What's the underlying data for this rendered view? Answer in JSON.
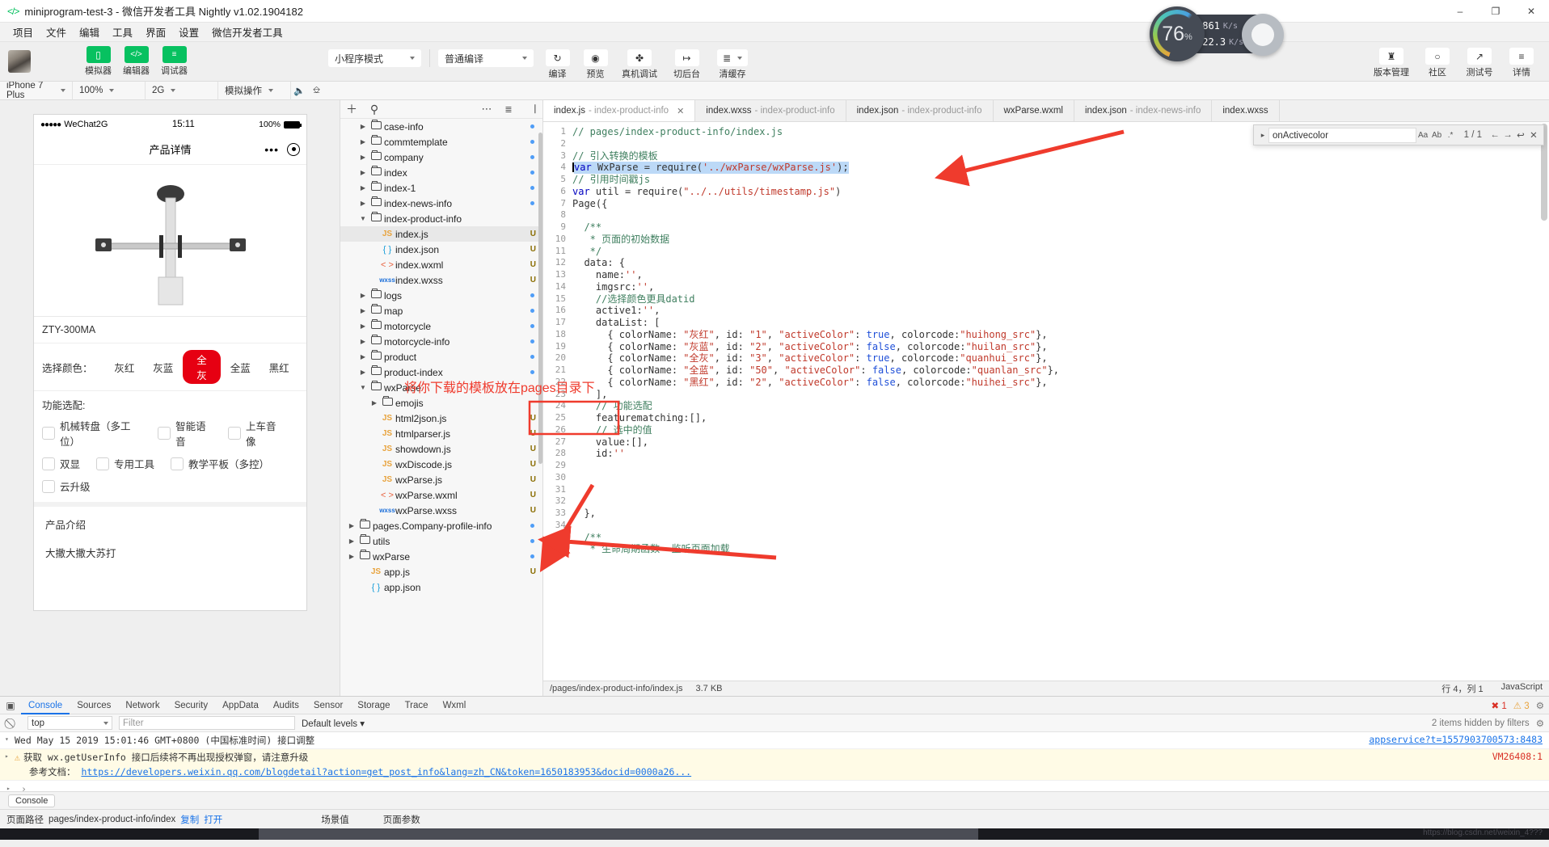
{
  "window": {
    "title": "miniprogram-test-3 - 微信开发者工具 Nightly v1.02.1904182",
    "logo_icon": "code-brackets-icon",
    "minimize": "–",
    "maximize": "❐",
    "close": "✕"
  },
  "menubar": [
    "项目",
    "文件",
    "编辑",
    "工具",
    "界面",
    "设置",
    "微信开发者工具"
  ],
  "toolbar": {
    "panels": [
      {
        "label": "模拟器",
        "icon": "phone-icon",
        "glyph": "▯",
        "active": true
      },
      {
        "label": "编辑器",
        "icon": "code-icon",
        "glyph": "</>",
        "active": true
      },
      {
        "label": "调试器",
        "icon": "sliders-icon",
        "glyph": "≡",
        "active": true
      }
    ],
    "mode_select": "小程序模式",
    "compile_select": "普通编译",
    "actions": [
      {
        "label": "编译",
        "icon": "refresh-icon",
        "glyph": "↻"
      },
      {
        "label": "预览",
        "icon": "eye-icon",
        "glyph": "◎"
      },
      {
        "label": "真机调试",
        "icon": "bug-icon",
        "glyph": "✤"
      },
      {
        "label": "切后台",
        "icon": "background-icon",
        "glyph": "↦"
      },
      {
        "label": "清缓存",
        "icon": "layers-icon",
        "glyph": "≣"
      }
    ],
    "right_actions": [
      {
        "label": "版本管理",
        "icon": "git-branch-icon",
        "glyph": "⛓"
      },
      {
        "label": "社区",
        "icon": "chat-bubble-icon",
        "glyph": "○"
      },
      {
        "label": "测试号",
        "icon": "external-link-icon",
        "glyph": "↗"
      },
      {
        "label": "详情",
        "icon": "hamburger-icon",
        "glyph": "≡"
      }
    ]
  },
  "cpu_meter": {
    "percent": "76",
    "percent_unit": "%",
    "upload": "861",
    "upload_unit": "K/s",
    "download": "22.3",
    "download_unit": "K/s",
    "up_arrow": "↑",
    "down_arrow": "↓"
  },
  "simbar": {
    "device": "iPhone 7 Plus",
    "zoom": "100%",
    "network": "2G",
    "action": "模拟操作",
    "icons": [
      "volume-icon",
      "screen-icon"
    ]
  },
  "simulator": {
    "status": {
      "signal_dots": "●●●●●",
      "carrier": "WeChat2G",
      "time": "15:11",
      "battery_pct": "100%"
    },
    "nav_title": "产品详情",
    "product_image_alt": "product-photo",
    "product_name": "ZTY-300MA",
    "color_label": "选择颜色：",
    "colors": [
      {
        "name": "灰红",
        "active": false
      },
      {
        "name": "灰蓝",
        "active": false
      },
      {
        "name": "全灰",
        "active": true
      },
      {
        "name": "全蓝",
        "active": false
      },
      {
        "name": "黑红",
        "active": false
      }
    ],
    "feature_label": "功能选配:",
    "features_row1": [
      "机械转盘（多工位）",
      "智能语音",
      "上车音像"
    ],
    "features_row2": [
      "双显",
      "专用工具",
      "教学平板（多控）"
    ],
    "features_row3": [
      "云升级"
    ],
    "intro_title": "产品介绍",
    "intro_body": "大撒大撒大苏打"
  },
  "filetree": {
    "toolbar": {
      "add": "＋",
      "search": "search-icon",
      "more": "⋯",
      "sort": "sort-icon",
      "collapse": "collapse-icon"
    },
    "items": [
      {
        "indent": 1,
        "type": "folder",
        "name": "case-info",
        "expanded": false,
        "badge": "dot"
      },
      {
        "indent": 1,
        "type": "folder",
        "name": "commtemplate",
        "expanded": false,
        "badge": "dot"
      },
      {
        "indent": 1,
        "type": "folder",
        "name": "company",
        "expanded": false,
        "badge": "dot"
      },
      {
        "indent": 1,
        "type": "folder",
        "name": "index",
        "expanded": false,
        "badge": "dot"
      },
      {
        "indent": 1,
        "type": "folder",
        "name": "index-1",
        "expanded": false,
        "badge": "dot"
      },
      {
        "indent": 1,
        "type": "folder",
        "name": "index-news-info",
        "expanded": false,
        "badge": "dot"
      },
      {
        "indent": 1,
        "type": "folder",
        "name": "index-product-info",
        "expanded": true,
        "badge": ""
      },
      {
        "indent": 2,
        "type": "js",
        "name": "index.js",
        "selected": true,
        "badge": "U"
      },
      {
        "indent": 2,
        "type": "json",
        "name": "index.json",
        "badge": "U"
      },
      {
        "indent": 2,
        "type": "wxml",
        "name": "index.wxml",
        "badge": "U"
      },
      {
        "indent": 2,
        "type": "wxss",
        "name": "index.wxss",
        "badge": "U"
      },
      {
        "indent": 1,
        "type": "folder",
        "name": "logs",
        "expanded": false,
        "badge": "dot"
      },
      {
        "indent": 1,
        "type": "folder",
        "name": "map",
        "expanded": false,
        "badge": "dot"
      },
      {
        "indent": 1,
        "type": "folder",
        "name": "motorcycle",
        "expanded": false,
        "badge": "dot"
      },
      {
        "indent": 1,
        "type": "folder",
        "name": "motorcycle-info",
        "expanded": false,
        "badge": "dot"
      },
      {
        "indent": 1,
        "type": "folder",
        "name": "product",
        "expanded": false,
        "badge": "dot"
      },
      {
        "indent": 1,
        "type": "folder",
        "name": "product-index",
        "expanded": false,
        "badge": "dot"
      },
      {
        "indent": 1,
        "type": "folder",
        "name": "wxParse",
        "expanded": true,
        "badge": ""
      },
      {
        "indent": 2,
        "type": "folder",
        "name": "emojis",
        "expanded": false,
        "badge": ""
      },
      {
        "indent": 2,
        "type": "js",
        "name": "html2json.js",
        "badge": "U"
      },
      {
        "indent": 2,
        "type": "js",
        "name": "htmlparser.js",
        "badge": "U"
      },
      {
        "indent": 2,
        "type": "js",
        "name": "showdown.js",
        "badge": "U"
      },
      {
        "indent": 2,
        "type": "js",
        "name": "wxDiscode.js",
        "badge": "U"
      },
      {
        "indent": 2,
        "type": "js",
        "name": "wxParse.js",
        "badge": "U"
      },
      {
        "indent": 2,
        "type": "wxml",
        "name": "wxParse.wxml",
        "badge": "U"
      },
      {
        "indent": 2,
        "type": "wxss",
        "name": "wxParse.wxss",
        "badge": "U"
      },
      {
        "indent": 0,
        "type": "folder",
        "name": "pages.Company-profile-info",
        "expanded": false,
        "badge": "dot"
      },
      {
        "indent": 0,
        "type": "folder",
        "name": "utils",
        "expanded": false,
        "badge": "dot"
      },
      {
        "indent": 0,
        "type": "folder",
        "name": "wxParse",
        "expanded": false,
        "badge": "dot"
      },
      {
        "indent": 1,
        "type": "js",
        "name": "app.js",
        "badge": "U"
      },
      {
        "indent": 1,
        "type": "json",
        "name": "app.json",
        "badge": ""
      }
    ]
  },
  "editor": {
    "tabs": [
      {
        "name": "index.js",
        "sub": "- index-product-info",
        "active": true,
        "closable": true
      },
      {
        "name": "index.wxss",
        "sub": "- index-product-info",
        "active": false
      },
      {
        "name": "index.json",
        "sub": "- index-product-info",
        "active": false
      },
      {
        "name": "wxParse.wxml",
        "sub": "",
        "active": false
      },
      {
        "name": "index.json",
        "sub": "- index-news-info",
        "active": false
      },
      {
        "name": "index.wxss",
        "sub": "",
        "active": false
      }
    ],
    "find": {
      "query": "onActivecolor",
      "match_case": "Aa",
      "whole_word": "Ab",
      "regex": ".*",
      "count": "1 / 1",
      "prev": "←",
      "next": "→",
      "expand": "↩",
      "close": "✕"
    },
    "lines": [
      {
        "n": 1,
        "tokens": [
          {
            "t": "// pages/index-product-info/index.js",
            "c": "cm"
          }
        ]
      },
      {
        "n": 2,
        "tokens": []
      },
      {
        "n": 3,
        "tokens": [
          {
            "t": "// 引入转换的模板",
            "c": "cm"
          }
        ]
      },
      {
        "n": 4,
        "selected": true,
        "tokens": [
          {
            "t": "var",
            "c": "kw"
          },
          {
            "t": " WxParse = require(",
            "c": "fn"
          },
          {
            "t": "'../wxParse/wxParse.js'",
            "c": "str"
          },
          {
            "t": ");",
            "c": "fn"
          }
        ]
      },
      {
        "n": 5,
        "tokens": [
          {
            "t": "// 引用时间戳js",
            "c": "cm"
          }
        ]
      },
      {
        "n": 6,
        "tokens": [
          {
            "t": "var",
            "c": "kw"
          },
          {
            "t": " util = require(",
            "c": "fn"
          },
          {
            "t": "\"../../utils/timestamp.js\"",
            "c": "str"
          },
          {
            "t": ")",
            "c": "fn"
          }
        ]
      },
      {
        "n": 7,
        "tokens": [
          {
            "t": "Page({",
            "c": "fn"
          }
        ]
      },
      {
        "n": 8,
        "tokens": []
      },
      {
        "n": 9,
        "tokens": [
          {
            "t": "  /**",
            "c": "cm"
          }
        ]
      },
      {
        "n": 10,
        "tokens": [
          {
            "t": "   * 页面的初始数据",
            "c": "cm"
          }
        ]
      },
      {
        "n": 11,
        "tokens": [
          {
            "t": "   */",
            "c": "cm"
          }
        ]
      },
      {
        "n": 12,
        "tokens": [
          {
            "t": "  data: {",
            "c": "fn"
          }
        ]
      },
      {
        "n": 13,
        "tokens": [
          {
            "t": "    name:",
            "c": "fn"
          },
          {
            "t": "''",
            "c": "str"
          },
          {
            "t": ",",
            "c": "fn"
          }
        ]
      },
      {
        "n": 14,
        "tokens": [
          {
            "t": "    imgsrc:",
            "c": "fn"
          },
          {
            "t": "''",
            "c": "str"
          },
          {
            "t": ",",
            "c": "fn"
          }
        ]
      },
      {
        "n": 15,
        "tokens": [
          {
            "t": "    //选择颜色更具datid",
            "c": "cm"
          }
        ]
      },
      {
        "n": 16,
        "tokens": [
          {
            "t": "    active1:",
            "c": "fn"
          },
          {
            "t": "''",
            "c": "str"
          },
          {
            "t": ",",
            "c": "fn"
          }
        ]
      },
      {
        "n": 17,
        "tokens": [
          {
            "t": "    dataList: [",
            "c": "fn"
          }
        ]
      },
      {
        "n": 18,
        "tokens": [
          {
            "t": "      { colorName: ",
            "c": "fn"
          },
          {
            "t": "\"灰红\"",
            "c": "str"
          },
          {
            "t": ", id: ",
            "c": "fn"
          },
          {
            "t": "\"1\"",
            "c": "str"
          },
          {
            "t": ", ",
            "c": "fn"
          },
          {
            "t": "\"activeColor\"",
            "c": "str"
          },
          {
            "t": ": ",
            "c": "fn"
          },
          {
            "t": "true",
            "c": "bool"
          },
          {
            "t": ", colorcode:",
            "c": "fn"
          },
          {
            "t": "\"huihong_src\"",
            "c": "str"
          },
          {
            "t": "},",
            "c": "fn"
          }
        ]
      },
      {
        "n": 19,
        "tokens": [
          {
            "t": "      { colorName: ",
            "c": "fn"
          },
          {
            "t": "\"灰蓝\"",
            "c": "str"
          },
          {
            "t": ", id: ",
            "c": "fn"
          },
          {
            "t": "\"2\"",
            "c": "str"
          },
          {
            "t": ", ",
            "c": "fn"
          },
          {
            "t": "\"activeColor\"",
            "c": "str"
          },
          {
            "t": ": ",
            "c": "fn"
          },
          {
            "t": "false",
            "c": "bool"
          },
          {
            "t": ", colorcode:",
            "c": "fn"
          },
          {
            "t": "\"huilan_src\"",
            "c": "str"
          },
          {
            "t": "},",
            "c": "fn"
          }
        ]
      },
      {
        "n": 20,
        "tokens": [
          {
            "t": "      { colorName: ",
            "c": "fn"
          },
          {
            "t": "\"全灰\"",
            "c": "str"
          },
          {
            "t": ", id: ",
            "c": "fn"
          },
          {
            "t": "\"3\"",
            "c": "str"
          },
          {
            "t": ", ",
            "c": "fn"
          },
          {
            "t": "\"activeColor\"",
            "c": "str"
          },
          {
            "t": ": ",
            "c": "fn"
          },
          {
            "t": "true",
            "c": "bool"
          },
          {
            "t": ", colorcode:",
            "c": "fn"
          },
          {
            "t": "\"quanhui_src\"",
            "c": "str"
          },
          {
            "t": "},",
            "c": "fn"
          }
        ]
      },
      {
        "n": 21,
        "tokens": [
          {
            "t": "      { colorName: ",
            "c": "fn"
          },
          {
            "t": "\"全蓝\"",
            "c": "str"
          },
          {
            "t": ", id: ",
            "c": "fn"
          },
          {
            "t": "\"50\"",
            "c": "str"
          },
          {
            "t": ", ",
            "c": "fn"
          },
          {
            "t": "\"activeColor\"",
            "c": "str"
          },
          {
            "t": ": ",
            "c": "fn"
          },
          {
            "t": "false",
            "c": "bool"
          },
          {
            "t": ", colorcode:",
            "c": "fn"
          },
          {
            "t": "\"quanlan_src\"",
            "c": "str"
          },
          {
            "t": "},",
            "c": "fn"
          }
        ]
      },
      {
        "n": 22,
        "tokens": [
          {
            "t": "      { colorName: ",
            "c": "fn"
          },
          {
            "t": "\"黑红\"",
            "c": "str"
          },
          {
            "t": ", id: ",
            "c": "fn"
          },
          {
            "t": "\"2\"",
            "c": "str"
          },
          {
            "t": ", ",
            "c": "fn"
          },
          {
            "t": "\"activeColor\"",
            "c": "str"
          },
          {
            "t": ": ",
            "c": "fn"
          },
          {
            "t": "false",
            "c": "bool"
          },
          {
            "t": ", colorcode:",
            "c": "fn"
          },
          {
            "t": "\"huihei_src\"",
            "c": "str"
          },
          {
            "t": "},",
            "c": "fn"
          }
        ]
      },
      {
        "n": 23,
        "tokens": [
          {
            "t": "    ],",
            "c": "fn"
          }
        ]
      },
      {
        "n": 24,
        "tokens": [
          {
            "t": "    // 功能选配",
            "c": "cm"
          }
        ]
      },
      {
        "n": 25,
        "tokens": [
          {
            "t": "    featurematching:[],",
            "c": "fn"
          }
        ]
      },
      {
        "n": 26,
        "tokens": [
          {
            "t": "    // 选中的值",
            "c": "cm"
          }
        ]
      },
      {
        "n": 27,
        "tokens": [
          {
            "t": "    value:[],",
            "c": "fn"
          }
        ]
      },
      {
        "n": 28,
        "tokens": [
          {
            "t": "    id:",
            "c": "fn"
          },
          {
            "t": "''",
            "c": "str"
          }
        ]
      },
      {
        "n": 29,
        "tokens": []
      },
      {
        "n": 30,
        "tokens": []
      },
      {
        "n": 31,
        "tokens": []
      },
      {
        "n": 32,
        "tokens": []
      },
      {
        "n": 33,
        "tokens": [
          {
            "t": "  },",
            "c": "fn"
          }
        ]
      },
      {
        "n": 34,
        "tokens": []
      },
      {
        "n": 35,
        "tokens": [
          {
            "t": "  /**",
            "c": "cm"
          }
        ]
      },
      {
        "n": 36,
        "tokens": [
          {
            "t": "   * 生命周期函数--监听页面加载",
            "c": "cm"
          }
        ]
      }
    ],
    "status": {
      "path": "/pages/index-product-info/index.js",
      "size": "3.7 KB",
      "cursor": "行 4，列 1",
      "language": "JavaScript"
    }
  },
  "devtools": {
    "panel_icon": "inspect-icon",
    "tabs": [
      "Console",
      "Sources",
      "Network",
      "Security",
      "AppData",
      "Audits",
      "Sensor",
      "Storage",
      "Trace",
      "Wxml"
    ],
    "active_tab": "Console",
    "counts": {
      "errors": "1",
      "warnings": "3",
      "error_icon": "✖",
      "warning_icon": "⚠"
    },
    "settings_icon": "gear-icon",
    "filterbar": {
      "clear_icon": "clear-icon",
      "context": "top",
      "filter_placeholder": "Filter",
      "levels": "Default levels",
      "hidden_note": "2 items hidden by filters",
      "gear_icon": "gear-icon"
    },
    "logs": [
      {
        "type": "info",
        "text": "Wed May 15 2019 15:01:46 GMT+0800 (中国标准时间)  接口调整",
        "source": "appservice?t=1557903700573:8483",
        "expandable": true
      },
      {
        "type": "warn",
        "text": "获取 wx.getUserInfo 接口后续将不再出现授权弹窗，请注意升级",
        "source": "VM26408:1",
        "note": "参考文档：",
        "link": "https://developers.weixin.qq.com/blogdetail?action=get_post_info&lang=zh_CN&token=1650183953&docid=0000a26..."
      }
    ],
    "prompt": "›",
    "footer_tab": "Console"
  },
  "statusbar": {
    "page_path_label": "页面路径",
    "page_path": "pages/index-product-info/index",
    "copy": "复制",
    "open": "打开",
    "scene_label": "场景值",
    "params_label": "页面参数"
  },
  "annotations": [
    {
      "text": "将你下载的模板放在pages目录下"
    }
  ],
  "watermark": "https://blog.csdn.net/weixin_4???"
}
